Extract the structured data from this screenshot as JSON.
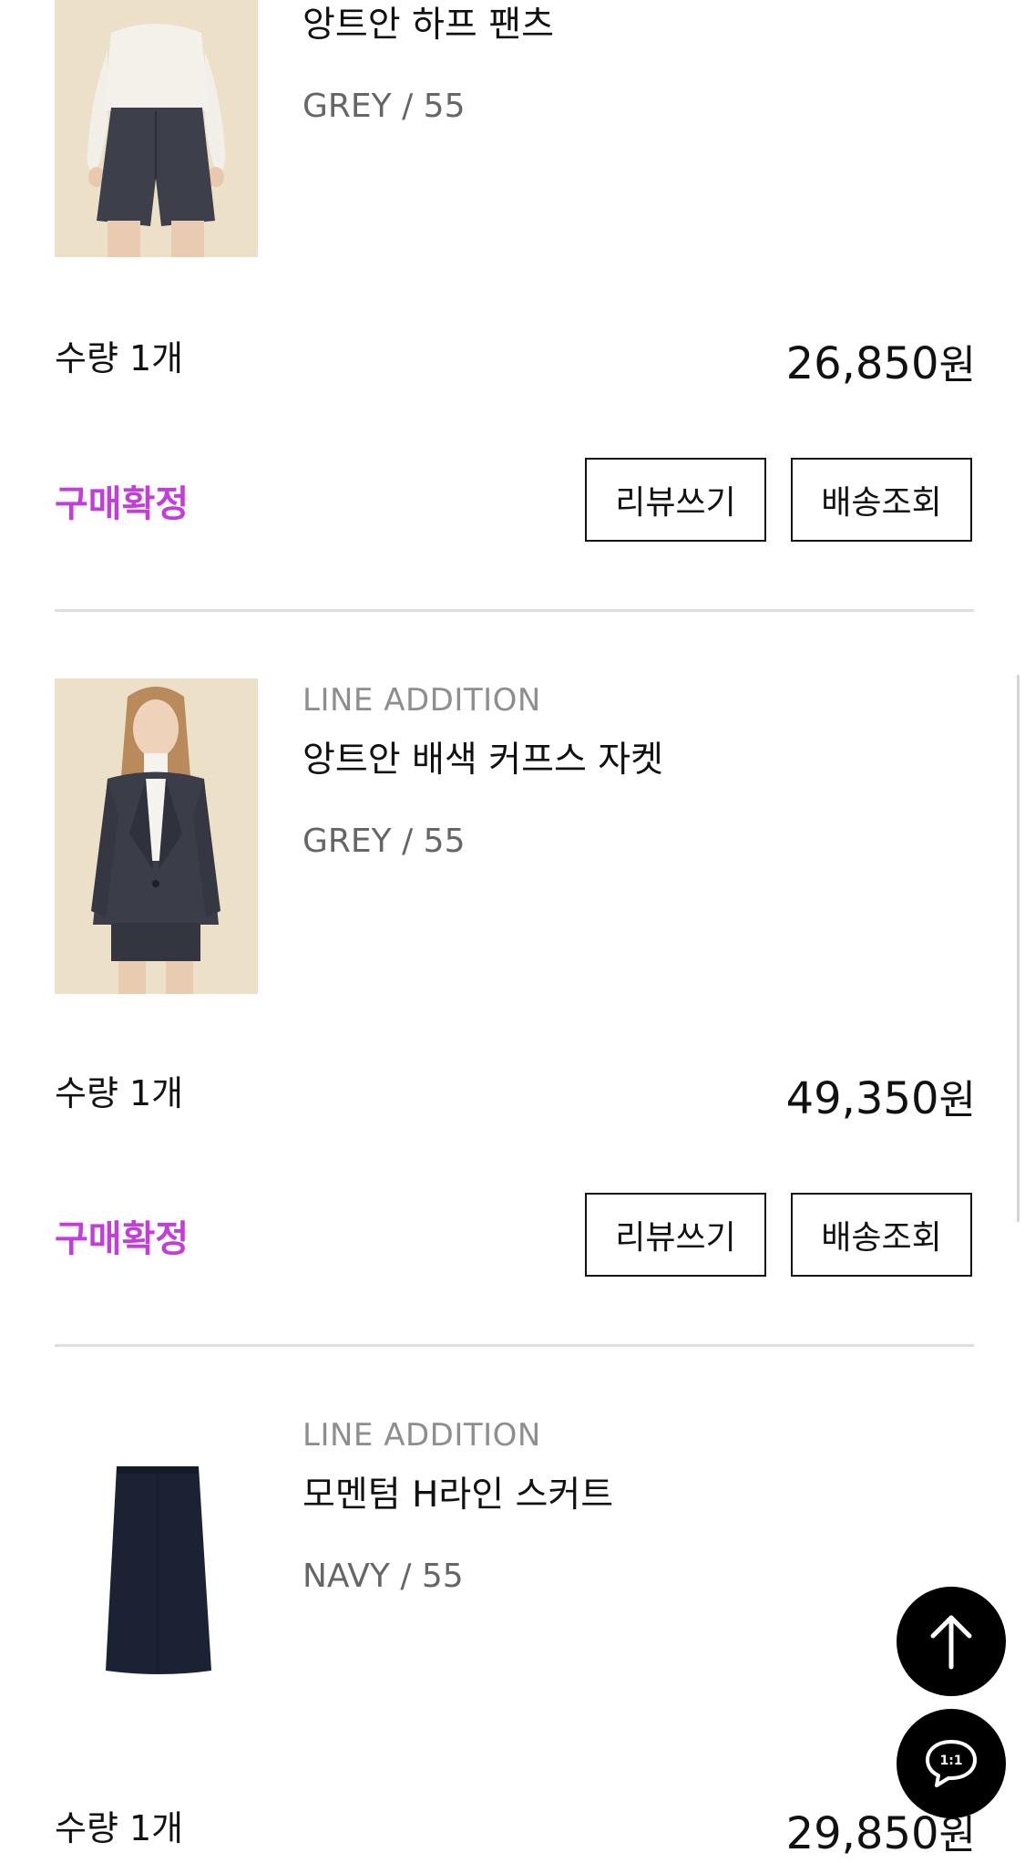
{
  "colors": {
    "status_accent": "#c13ed8",
    "text_primary": "#111111",
    "text_muted": "#8e8e8e",
    "divider": "#dedede",
    "fab_background": "#000000"
  },
  "orders": [
    {
      "brand": "",
      "name": "앙트안 하프 팬츠",
      "option": "GREY / 55",
      "quantity": "수량 1개",
      "price": "26,850",
      "price_unit": "원",
      "status": "구매확정",
      "review_label": "리뷰쓰기",
      "shipping_label": "배송조회",
      "image_icon": "half-pants-photo"
    },
    {
      "brand": "LINE ADDITION",
      "name": "앙트안 배색 커프스 자켓",
      "option": "GREY / 55",
      "quantity": "수량 1개",
      "price": "49,350",
      "price_unit": "원",
      "status": "구매확정",
      "review_label": "리뷰쓰기",
      "shipping_label": "배송조회",
      "image_icon": "jacket-photo"
    },
    {
      "brand": "LINE ADDITION",
      "name": "모멘텀 H라인 스커트",
      "option": "NAVY / 55",
      "quantity": "수량 1개",
      "price": "29,850",
      "price_unit": "원",
      "image_icon": "skirt-photo"
    }
  ],
  "floating": {
    "scroll_top_icon": "arrow-up-icon",
    "chat_icon": "chat-bubble-icon",
    "chat_badge": "1:1"
  }
}
